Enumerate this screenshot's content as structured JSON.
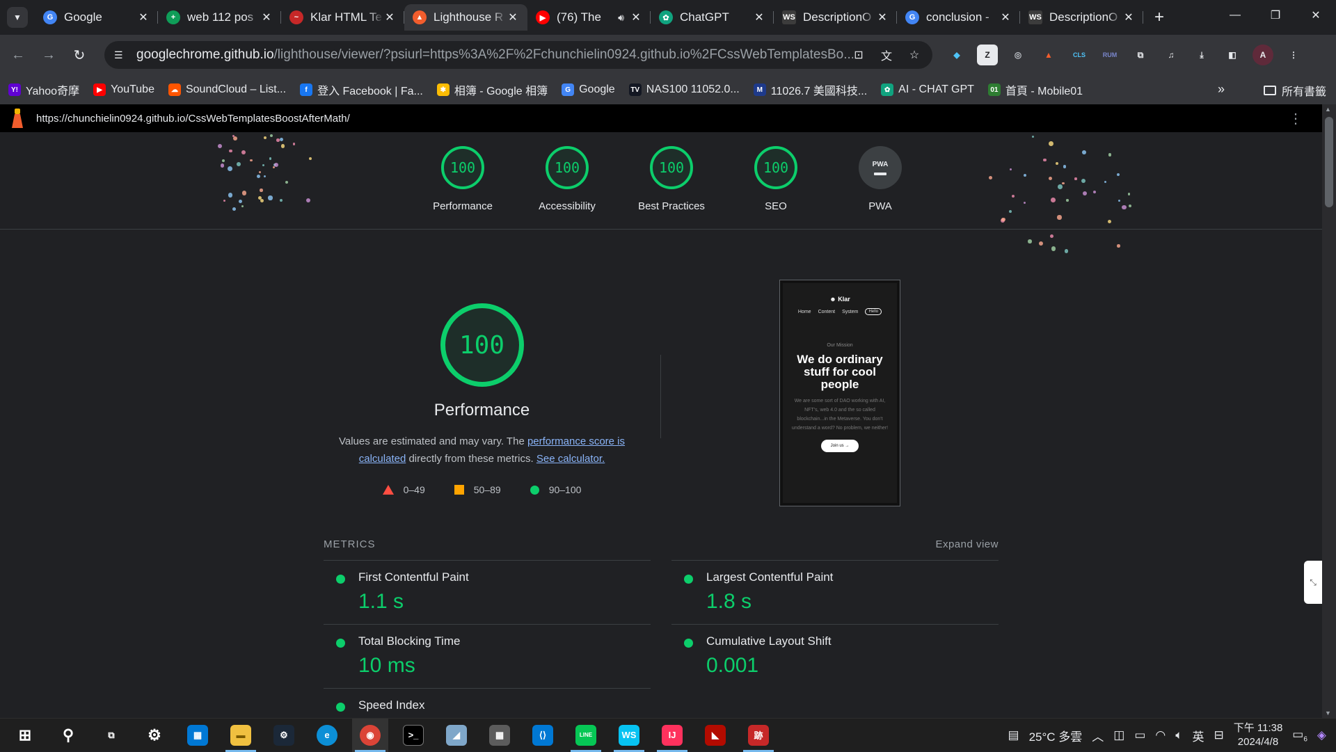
{
  "browser": {
    "tabs": [
      {
        "title": "Google",
        "favicon": "google-icon",
        "color": "#4285f4",
        "glyph": "G"
      },
      {
        "title": "web 112 pos",
        "favicon": "sheets-icon",
        "color": "#0f9d58",
        "glyph": "+"
      },
      {
        "title": "Klar HTML Te",
        "favicon": "klar-icon",
        "color": "#c62828",
        "glyph": "~"
      },
      {
        "title": "Lighthouse R",
        "favicon": "lighthouse-icon",
        "color": "#f25d2d",
        "glyph": "▲",
        "active": true
      },
      {
        "title": "(76) The",
        "favicon": "youtube-icon",
        "color": "#ff0000",
        "glyph": "▶",
        "audio": true
      },
      {
        "title": "ChatGPT",
        "favicon": "chatgpt-icon",
        "color": "#10a37f",
        "glyph": "✿"
      },
      {
        "title": "DescriptionO",
        "favicon": "webstorm-icon",
        "color": "#3c3c3c",
        "glyph": "WS"
      },
      {
        "title": "conclusion -",
        "favicon": "google-icon",
        "color": "#4285f4",
        "glyph": "G"
      },
      {
        "title": "DescriptionO",
        "favicon": "webstorm-icon",
        "color": "#3c3c3c",
        "glyph": "WS"
      }
    ],
    "url_domain": "googlechrome.github.io",
    "url_rest": "/lighthouse/viewer/?psiurl=https%3A%2F%2Fchunchielin0924.github.io%2FCssWebTemplatesBo...",
    "bookmarks": [
      {
        "label": "Yahoo奇摩",
        "color": "#6001d2",
        "glyph": "Y!"
      },
      {
        "label": "YouTube",
        "color": "#ff0000",
        "glyph": "▶"
      },
      {
        "label": "SoundCloud – List...",
        "color": "#ff5500",
        "glyph": "☁"
      },
      {
        "label": "登入 Facebook | Fa...",
        "color": "#1877f2",
        "glyph": "f"
      },
      {
        "label": "相簿 - Google 相簿",
        "color": "#fbbc04",
        "glyph": "✱"
      },
      {
        "label": "Google",
        "color": "#4285f4",
        "glyph": "G"
      },
      {
        "label": "NAS100 11052.0...",
        "color": "#131722",
        "glyph": "TV"
      },
      {
        "label": "11026.7 美國科技...",
        "color": "#1e3a8a",
        "glyph": "M"
      },
      {
        "label": "AI - CHAT GPT",
        "color": "#10a37f",
        "glyph": "✿"
      },
      {
        "label": "首頁 - Mobile01",
        "color": "#2e7d32",
        "glyph": "01"
      }
    ],
    "all_bookmarks_label": "所有書籤"
  },
  "lighthouse": {
    "report_url": "https://chunchielin0924.github.io/CssWebTemplatesBoostAfterMath/",
    "categories": [
      {
        "label": "Performance",
        "score": "100"
      },
      {
        "label": "Accessibility",
        "score": "100"
      },
      {
        "label": "Best Practices",
        "score": "100"
      },
      {
        "label": "SEO",
        "score": "100"
      }
    ],
    "pwa": {
      "label": "PWA",
      "badge": "PWA"
    },
    "performance": {
      "score": "100",
      "title": "Performance",
      "desc_prefix": "Values are estimated and may vary. The ",
      "desc_link1": "performance score is calculated",
      "desc_mid": " directly from these metrics. ",
      "desc_link2": "See calculator."
    },
    "legend": [
      {
        "range": "0–49",
        "color": "#ff4e42"
      },
      {
        "range": "50–89",
        "color": "#ffa400"
      },
      {
        "range": "90–100",
        "color": "#0cce6b"
      }
    ],
    "screenshot": {
      "brand": "☻ Klar",
      "nav": [
        "Home",
        "Content",
        "System"
      ],
      "nav_button": "Hello",
      "kicker": "Our Mission",
      "heading": "We do ordinary stuff for cool people",
      "body": "We are some sort of DAO working with AI, NFT's, web 4.0 and the so called blockchain...in the Metaverse. You don't understand a word? No problem, we neither!",
      "button": "Join us →"
    },
    "metrics_label": "METRICS",
    "expand_label": "Expand view",
    "metrics": [
      {
        "name": "First Contentful Paint",
        "value": "1.1 s"
      },
      {
        "name": "Largest Contentful Paint",
        "value": "1.8 s"
      },
      {
        "name": "Total Blocking Time",
        "value": "10 ms"
      },
      {
        "name": "Cumulative Layout Shift",
        "value": "0.001"
      },
      {
        "name": "Speed Index",
        "value": ""
      }
    ],
    "good_color": "#0cce6b"
  },
  "taskbar": {
    "weather": "25°C 多雲",
    "ime": "英",
    "time": "下午 11:38",
    "date": "2024/4/8",
    "notifications": "6"
  }
}
